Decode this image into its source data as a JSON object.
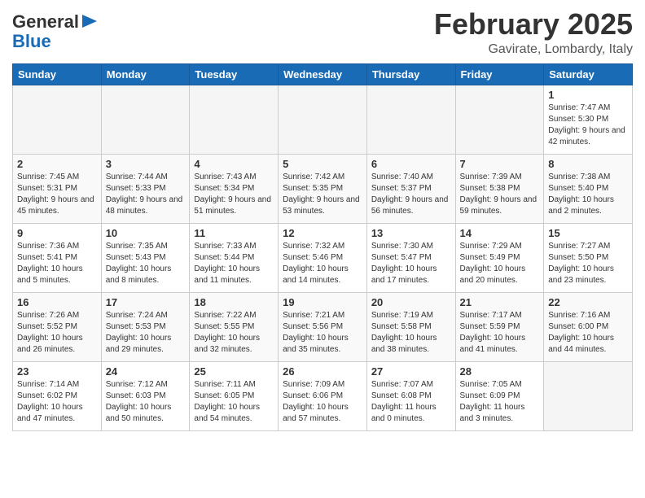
{
  "header": {
    "logo_line1": "General",
    "logo_line2": "Blue",
    "month": "February 2025",
    "location": "Gavirate, Lombardy, Italy"
  },
  "weekdays": [
    "Sunday",
    "Monday",
    "Tuesday",
    "Wednesday",
    "Thursday",
    "Friday",
    "Saturday"
  ],
  "weeks": [
    [
      {
        "day": "",
        "info": ""
      },
      {
        "day": "",
        "info": ""
      },
      {
        "day": "",
        "info": ""
      },
      {
        "day": "",
        "info": ""
      },
      {
        "day": "",
        "info": ""
      },
      {
        "day": "",
        "info": ""
      },
      {
        "day": "1",
        "info": "Sunrise: 7:47 AM\nSunset: 5:30 PM\nDaylight: 9 hours and 42 minutes."
      }
    ],
    [
      {
        "day": "2",
        "info": "Sunrise: 7:45 AM\nSunset: 5:31 PM\nDaylight: 9 hours and 45 minutes."
      },
      {
        "day": "3",
        "info": "Sunrise: 7:44 AM\nSunset: 5:33 PM\nDaylight: 9 hours and 48 minutes."
      },
      {
        "day": "4",
        "info": "Sunrise: 7:43 AM\nSunset: 5:34 PM\nDaylight: 9 hours and 51 minutes."
      },
      {
        "day": "5",
        "info": "Sunrise: 7:42 AM\nSunset: 5:35 PM\nDaylight: 9 hours and 53 minutes."
      },
      {
        "day": "6",
        "info": "Sunrise: 7:40 AM\nSunset: 5:37 PM\nDaylight: 9 hours and 56 minutes."
      },
      {
        "day": "7",
        "info": "Sunrise: 7:39 AM\nSunset: 5:38 PM\nDaylight: 9 hours and 59 minutes."
      },
      {
        "day": "8",
        "info": "Sunrise: 7:38 AM\nSunset: 5:40 PM\nDaylight: 10 hours and 2 minutes."
      }
    ],
    [
      {
        "day": "9",
        "info": "Sunrise: 7:36 AM\nSunset: 5:41 PM\nDaylight: 10 hours and 5 minutes."
      },
      {
        "day": "10",
        "info": "Sunrise: 7:35 AM\nSunset: 5:43 PM\nDaylight: 10 hours and 8 minutes."
      },
      {
        "day": "11",
        "info": "Sunrise: 7:33 AM\nSunset: 5:44 PM\nDaylight: 10 hours and 11 minutes."
      },
      {
        "day": "12",
        "info": "Sunrise: 7:32 AM\nSunset: 5:46 PM\nDaylight: 10 hours and 14 minutes."
      },
      {
        "day": "13",
        "info": "Sunrise: 7:30 AM\nSunset: 5:47 PM\nDaylight: 10 hours and 17 minutes."
      },
      {
        "day": "14",
        "info": "Sunrise: 7:29 AM\nSunset: 5:49 PM\nDaylight: 10 hours and 20 minutes."
      },
      {
        "day": "15",
        "info": "Sunrise: 7:27 AM\nSunset: 5:50 PM\nDaylight: 10 hours and 23 minutes."
      }
    ],
    [
      {
        "day": "16",
        "info": "Sunrise: 7:26 AM\nSunset: 5:52 PM\nDaylight: 10 hours and 26 minutes."
      },
      {
        "day": "17",
        "info": "Sunrise: 7:24 AM\nSunset: 5:53 PM\nDaylight: 10 hours and 29 minutes."
      },
      {
        "day": "18",
        "info": "Sunrise: 7:22 AM\nSunset: 5:55 PM\nDaylight: 10 hours and 32 minutes."
      },
      {
        "day": "19",
        "info": "Sunrise: 7:21 AM\nSunset: 5:56 PM\nDaylight: 10 hours and 35 minutes."
      },
      {
        "day": "20",
        "info": "Sunrise: 7:19 AM\nSunset: 5:58 PM\nDaylight: 10 hours and 38 minutes."
      },
      {
        "day": "21",
        "info": "Sunrise: 7:17 AM\nSunset: 5:59 PM\nDaylight: 10 hours and 41 minutes."
      },
      {
        "day": "22",
        "info": "Sunrise: 7:16 AM\nSunset: 6:00 PM\nDaylight: 10 hours and 44 minutes."
      }
    ],
    [
      {
        "day": "23",
        "info": "Sunrise: 7:14 AM\nSunset: 6:02 PM\nDaylight: 10 hours and 47 minutes."
      },
      {
        "day": "24",
        "info": "Sunrise: 7:12 AM\nSunset: 6:03 PM\nDaylight: 10 hours and 50 minutes."
      },
      {
        "day": "25",
        "info": "Sunrise: 7:11 AM\nSunset: 6:05 PM\nDaylight: 10 hours and 54 minutes."
      },
      {
        "day": "26",
        "info": "Sunrise: 7:09 AM\nSunset: 6:06 PM\nDaylight: 10 hours and 57 minutes."
      },
      {
        "day": "27",
        "info": "Sunrise: 7:07 AM\nSunset: 6:08 PM\nDaylight: 11 hours and 0 minutes."
      },
      {
        "day": "28",
        "info": "Sunrise: 7:05 AM\nSunset: 6:09 PM\nDaylight: 11 hours and 3 minutes."
      },
      {
        "day": "",
        "info": ""
      }
    ]
  ]
}
